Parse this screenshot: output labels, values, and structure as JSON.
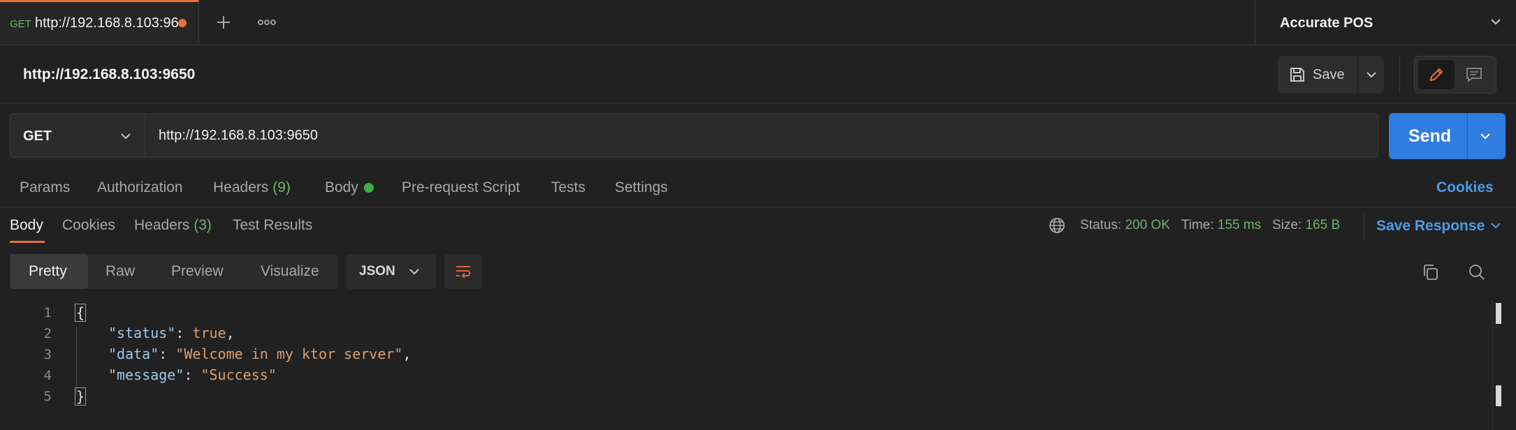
{
  "tab": {
    "method": "GET",
    "url": "http://192.168.8.103:96"
  },
  "environment": {
    "label": "Accurate POS"
  },
  "request": {
    "title": "http://192.168.8.103:9650",
    "save_label": "Save",
    "method": "GET",
    "url": "http://192.168.8.103:9650",
    "send_label": "Send"
  },
  "request_tabs": {
    "params": "Params",
    "authorization": "Authorization",
    "headers": "Headers",
    "headers_count": "(9)",
    "body": "Body",
    "pre_request_script": "Pre-request Script",
    "tests": "Tests",
    "settings": "Settings",
    "cookies": "Cookies"
  },
  "response_tabs": {
    "body": "Body",
    "cookies": "Cookies",
    "headers": "Headers",
    "headers_count": "(3)",
    "test_results": "Test Results"
  },
  "response_meta": {
    "status_label": "Status:",
    "status_value": "200 OK",
    "time_label": "Time:",
    "time_value": "155 ms",
    "size_label": "Size:",
    "size_value": "165 B",
    "save_response": "Save Response"
  },
  "view": {
    "pretty": "Pretty",
    "raw": "Raw",
    "preview": "Preview",
    "visualize": "Visualize",
    "format": "JSON"
  },
  "code": {
    "line_numbers": [
      "1",
      "2",
      "3",
      "4",
      "5"
    ],
    "open_brace": "{",
    "close_brace": "}",
    "k_status": "\"status\"",
    "v_status": "true",
    "k_data": "\"data\"",
    "v_data": "\"Welcome in my ktor server\"",
    "k_message": "\"message\"",
    "v_message": "\"Success\"",
    "colon": ": ",
    "comma": ","
  },
  "colors": {
    "accent_orange": "#e8703a",
    "primary_blue": "#2f7de1",
    "link_blue": "#4a9ce8",
    "status_green": "#6bb36b",
    "string_value": "#d9a073",
    "json_key": "#9cc9e8"
  }
}
